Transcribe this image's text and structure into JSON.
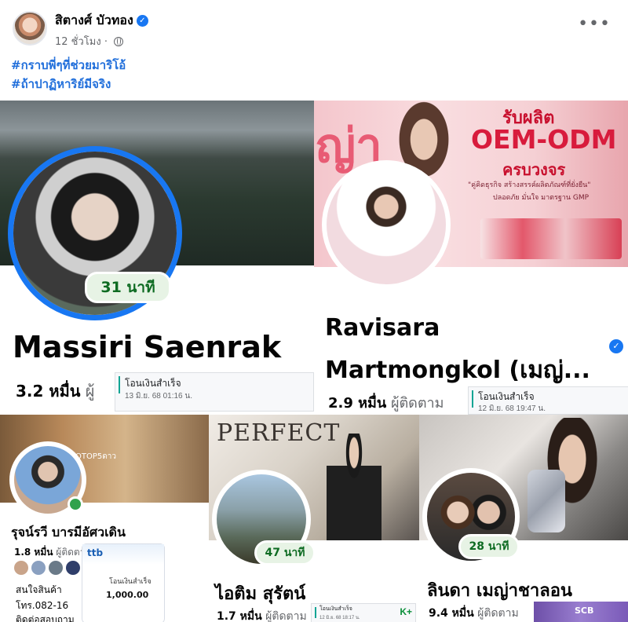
{
  "post": {
    "author": "สิตางศ์ บัวทอง",
    "time": "12 ชั่วโมง",
    "hashtags": [
      "#กราบพี่ๆที่ช่วยมาริโอ้",
      "#ถ้าปาฏิหาริย์มีจริง"
    ],
    "more_label": "•••",
    "verified_mark": "✓"
  },
  "panels": {
    "p1": {
      "name": "Massiri Saenrak",
      "badge": "31 นาที",
      "followers": "3.2 หมื่น",
      "followers_suffix": "ผู้",
      "receipt_title": "โอนเงินสำเร็จ",
      "receipt_date": "13 มิ.ย. 68  01:16 น."
    },
    "p2": {
      "name_line1": "Ravisara",
      "name_line2": "Martmongkol (เมญ่...",
      "followers": "2.9 หมื่น",
      "followers_suffix": "ผู้ติดตาม",
      "receipt_title": "โอนเงินสำเร็จ",
      "receipt_date": "12 มิ.ย. 68  19:47 น.",
      "cover_line1": "รับผลิต",
      "cover_line2": "OEM-ODM",
      "cover_line3": "ครบวงจร",
      "cover_line4": "\"คู่คิดธุรกิจ สร้างสรรค์ผลิตภัณฑ์ที่ยั่งยืน\"",
      "cover_line5": "ปลอดภัย มั่นใจ มาตรฐาน GMP",
      "cover_big": "ญ่า"
    },
    "p3": {
      "name": "รุจน์รวี บารมีอัศวเดิน",
      "followers": "1.8 หมื่น",
      "followers_suffix": "ผู้ติดตา",
      "bank": "ttb",
      "slip_title": "โอนเงินสำเร็จ",
      "slip_amount": "1,000.00",
      "line1": "สนใจสินค้า",
      "line2": "โทร.082-16",
      "line3": "ติดต่อสอบถาม",
      "cover_text": "OTOP5ดาว"
    },
    "p4": {
      "name": "ไอติม สุรัตน์",
      "badge": "47 นาที",
      "followers": "1.7 หมื่น",
      "followers_suffix": "ผู้ติดตาม",
      "receipt_title": "โอนเงินสำเร็จ",
      "receipt_date": "12 มิ.ย. 68  18:17 น.",
      "bank": "K+",
      "cover_text": "PERFECT"
    },
    "p5": {
      "name": "ลินดา เมญ่าชาลอน",
      "badge": "28 นาที",
      "followers": "9.4 หมื่น",
      "followers_suffix": "ผู้ติดตาม",
      "bank": "SCB"
    }
  },
  "colors": {
    "link": "#216fdb",
    "facebook_blue": "#1877f2",
    "badge_green": "#0e6b22"
  }
}
